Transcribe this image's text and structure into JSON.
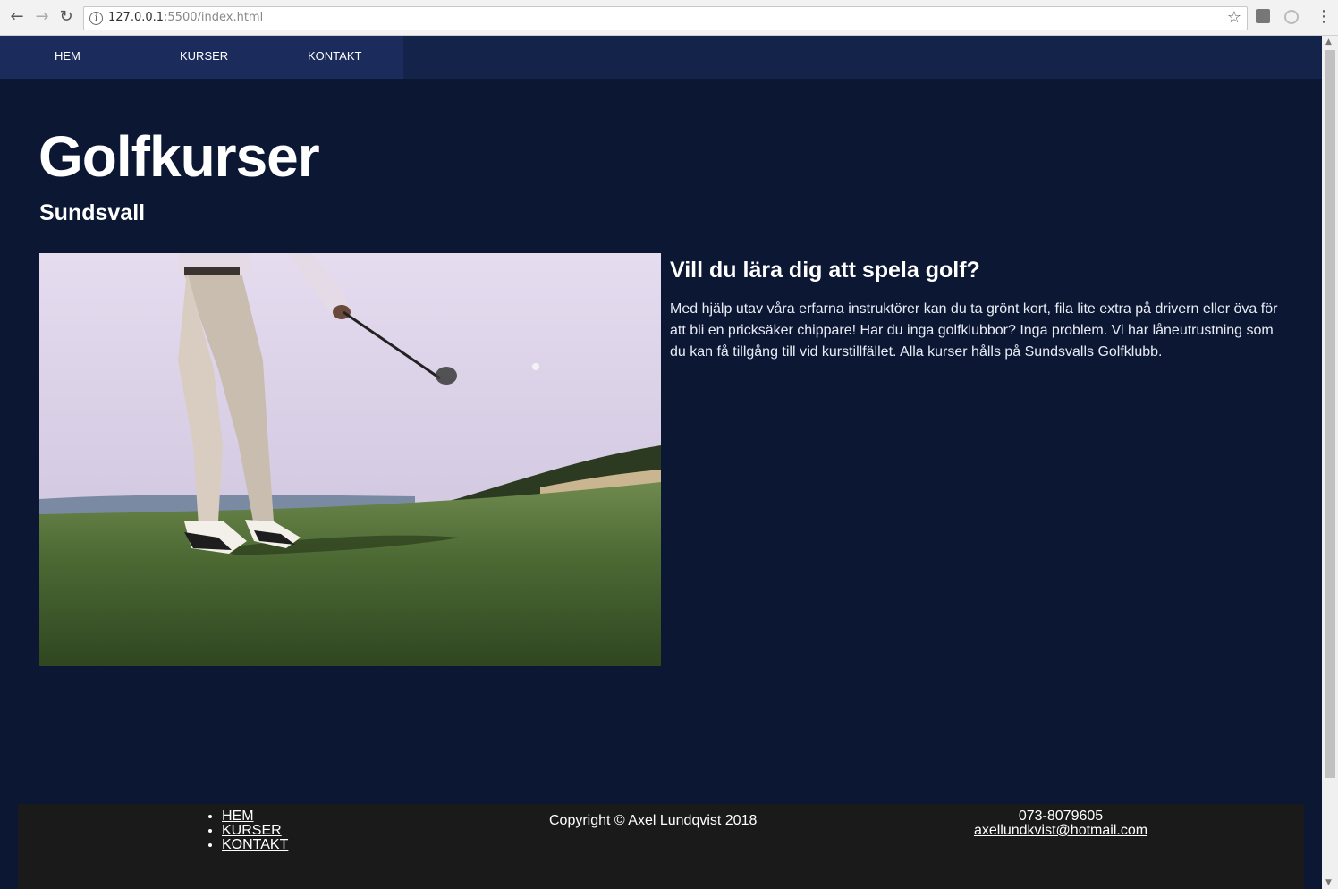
{
  "browser": {
    "url_host": "127.0.0.1",
    "url_rest": ":5500/index.html"
  },
  "nav": {
    "items": [
      {
        "label": "HEM"
      },
      {
        "label": "KURSER"
      },
      {
        "label": "KONTAKT"
      }
    ]
  },
  "hero": {
    "title": "Golfkurser",
    "subtitle": "Sundsvall"
  },
  "article": {
    "title": "Vill du lära dig att spela golf?",
    "body": "Med hjälp utav våra erfarna instruktörer kan du ta grönt kort, fila lite extra på drivern eller öva för att bli en pricksäker chippare! Har du inga golfklubbor? Inga problem. Vi har låneutrustning som du kan få tillgång till vid kurstillfället. Alla kurser hålls på Sundsvalls Golfklubb."
  },
  "footer": {
    "links": [
      {
        "label": "HEM"
      },
      {
        "label": "KURSER"
      },
      {
        "label": "KONTAKT"
      }
    ],
    "copyright": "Copyright © Axel Lundqvist 2018",
    "phone": "073-8079605",
    "email": "axellundkvist@hotmail.com"
  },
  "colors": {
    "page_bg": "#0b1733",
    "nav_bg": "#1b2c5c",
    "footer_bg": "#1a1a1a"
  }
}
